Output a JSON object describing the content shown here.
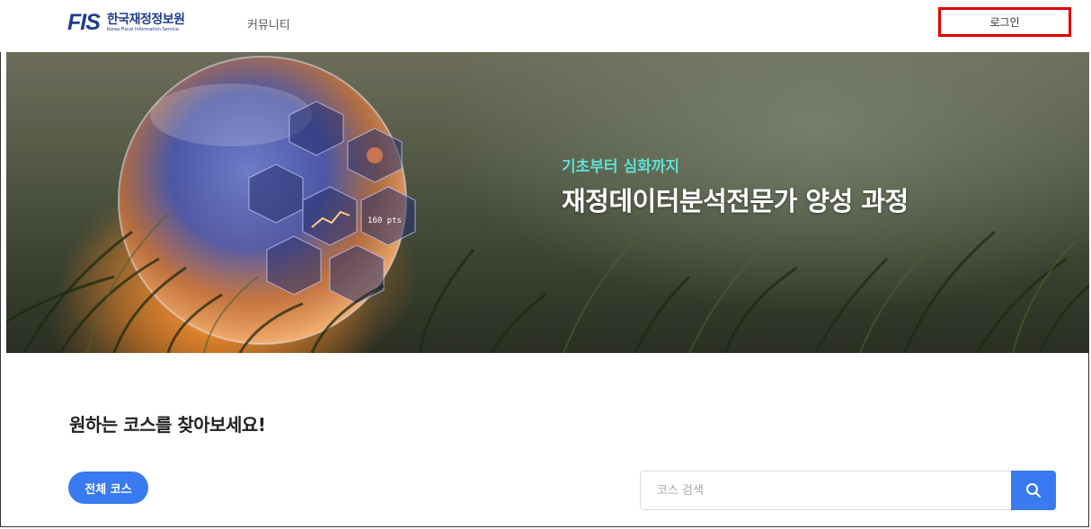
{
  "header": {
    "logo_mark": "FIS",
    "logo_title": "한국재정정보원",
    "logo_subtitle": "Korea Fiscal Information Service",
    "nav_community": "커뮤니티",
    "login_label": "로그인"
  },
  "hero": {
    "subtitle": "기초부터 심화까지",
    "title": "재정데이터분석전문가 양성 과정",
    "overlay_text": "160 pts"
  },
  "main": {
    "section_title": "원하는 코스를 찾아보세요!",
    "all_courses_label": "전체 코스",
    "search_placeholder": "코스 검색"
  },
  "colors": {
    "brand": "#1f3c8f",
    "accent": "#3a7af0",
    "hero_subtitle": "#5fe0d5",
    "login_highlight": "#e00000"
  },
  "icons": {
    "search": "search-icon"
  }
}
